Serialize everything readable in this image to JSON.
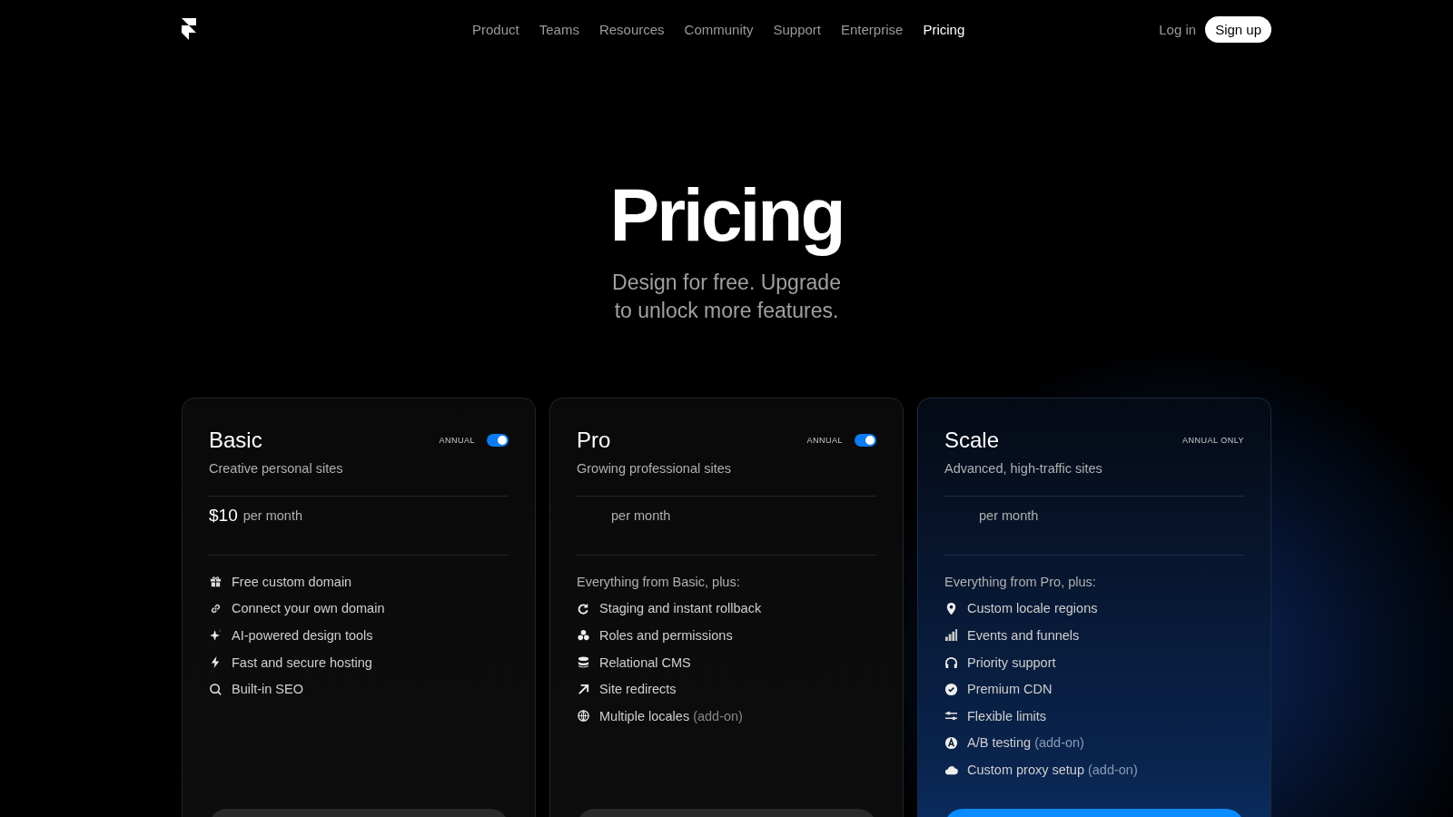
{
  "nav": {
    "links": [
      {
        "label": "Product",
        "selected": false
      },
      {
        "label": "Teams",
        "selected": false
      },
      {
        "label": "Resources",
        "selected": false
      },
      {
        "label": "Community",
        "selected": false
      },
      {
        "label": "Support",
        "selected": false
      },
      {
        "label": "Enterprise",
        "selected": false
      },
      {
        "label": "Pricing",
        "selected": true
      }
    ],
    "login": "Log in",
    "signup": "Sign up"
  },
  "hero": {
    "title": "Pricing",
    "subtitle_lines": [
      "Design for free. Upgrade",
      "to unlock more features."
    ]
  },
  "plans": [
    {
      "name": "Basic",
      "tagline": "Creative personal sites",
      "billing": {
        "kind": "toggle",
        "label": "ANNUAL",
        "on": true
      },
      "price": "$10",
      "period": "per month",
      "featured": false,
      "features": [
        {
          "kind": "gift",
          "label": "Free custom domain"
        },
        {
          "kind": "link",
          "label": "Connect your own domain"
        },
        {
          "kind": "sparkle",
          "label": "AI-powered design tools"
        },
        {
          "kind": "bolt",
          "label": "Fast and secure hosting"
        },
        {
          "kind": "search",
          "label": "Built-in SEO"
        }
      ]
    },
    {
      "name": "Pro",
      "tagline": "Growing professional sites",
      "billing": {
        "kind": "toggle",
        "label": "ANNUAL",
        "on": true
      },
      "period": "per month",
      "intro": "Everything from Basic, plus:",
      "featured": false,
      "features": [
        {
          "kind": "refresh",
          "label": "Staging and instant rollback"
        },
        {
          "kind": "people",
          "label": "Roles and permissions"
        },
        {
          "kind": "database",
          "label": "Relational CMS"
        },
        {
          "kind": "arrow",
          "label": "Site redirects"
        },
        {
          "kind": "globe",
          "label": "Multiple locales",
          "note": "(add-on)"
        }
      ]
    },
    {
      "name": "Scale",
      "tagline": "Advanced, high-traffic sites",
      "billing": {
        "kind": "note",
        "label": "ANNUAL ONLY"
      },
      "period": "per month",
      "intro": "Everything from Pro, plus:",
      "featured": true,
      "features": [
        {
          "kind": "pin",
          "label": "Custom locale regions"
        },
        {
          "kind": "bars",
          "label": "Events and funnels"
        },
        {
          "kind": "headphones",
          "label": "Priority support"
        },
        {
          "kind": "badge",
          "label": "Premium CDN"
        },
        {
          "kind": "sliders",
          "label": "Flexible limits"
        },
        {
          "kind": "ab",
          "label": "A/B testing",
          "note": "(add-on)"
        },
        {
          "kind": "cloud",
          "label": "Custom proxy setup",
          "note": "(add-on)"
        }
      ]
    }
  ]
}
